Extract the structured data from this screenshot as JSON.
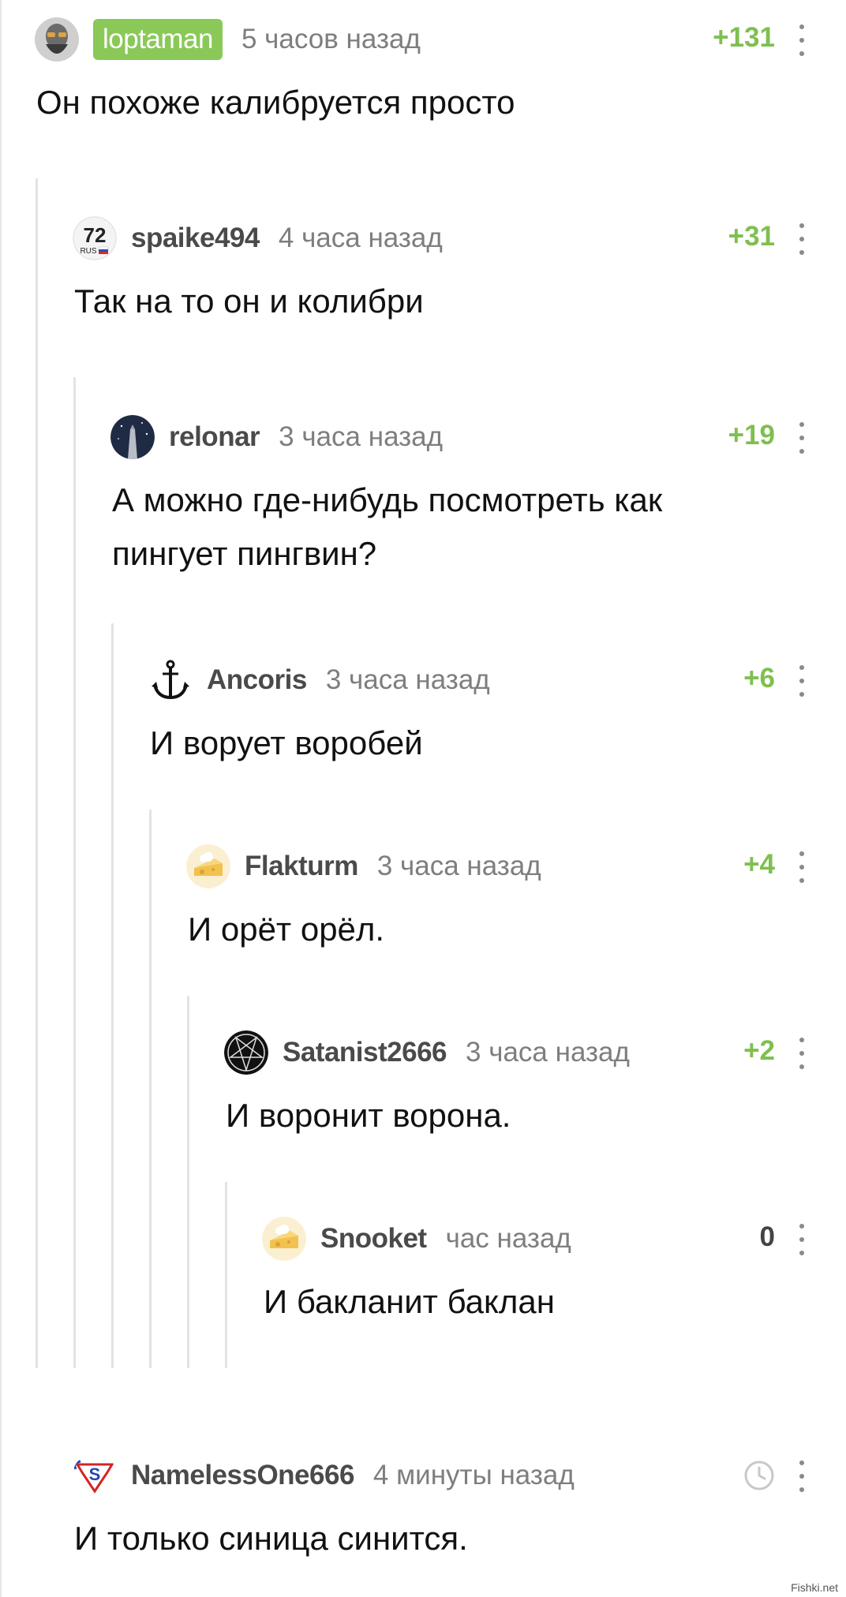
{
  "comments": [
    {
      "author": "loptaman",
      "time": "5 часов назад",
      "rating": "+131",
      "text": "Он похоже калибруется просто",
      "avatar": "bearded-man-avatar"
    },
    {
      "author": "spaike494",
      "time": "4 часа назад",
      "rating": "+31",
      "text": "Так на то он и колибри",
      "avatar": "car-plate-72-rus-avatar",
      "avatar_text": {
        "number": "72",
        "region": "RUS"
      }
    },
    {
      "author": "relonar",
      "time": "3 часа назад",
      "rating": "+19",
      "text_lines": [
        "А можно где-нибудь посмотреть как",
        "пингует пингвин?"
      ],
      "avatar": "night-sky-tower-avatar"
    },
    {
      "author": "Ancoris",
      "time": "3 часа назад",
      "rating": "+6",
      "text": "И ворует воробей",
      "avatar": "anchor-avatar"
    },
    {
      "author": "Flakturm",
      "time": "3 часа назад",
      "rating": "+4",
      "text": "И орёт орёл.",
      "avatar": "default-cheese-avatar"
    },
    {
      "author": "Satanist2666",
      "time": "3 часа назад",
      "rating": "+2",
      "text": "И воронит ворона.",
      "avatar": "pentagram-avatar"
    },
    {
      "author": "Snooket",
      "time": "час назад",
      "rating": "0",
      "text": "И бакланит баклан",
      "avatar": "default-cheese-avatar"
    },
    {
      "author": "NamelessOne666",
      "time": "4 минуты назад",
      "rating_icon": "clock-icon",
      "text": "И только синица синится.",
      "avatar": "superman-logo-avatar"
    }
  ],
  "watermark": "Fishki.net",
  "colors": {
    "rating_positive": "#7fbf4f",
    "badge": "#8ac858",
    "author": "#4a4a4a",
    "time": "#7e7e7e",
    "thread_line": "#e3e3e3"
  }
}
